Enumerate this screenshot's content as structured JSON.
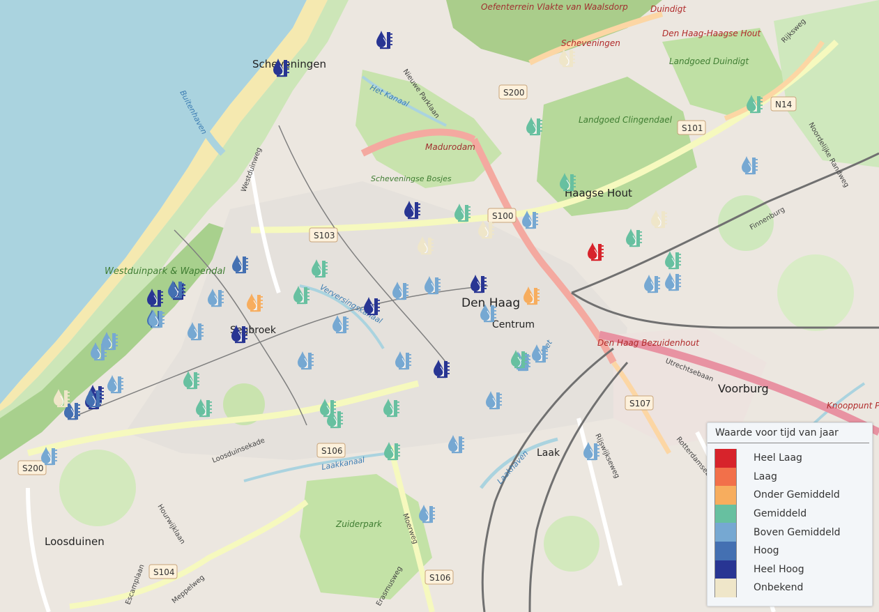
{
  "map": {
    "place_labels": [
      {
        "text": "Scheveningen",
        "kind": "district"
      },
      {
        "text": "Den Haag",
        "kind": "city"
      },
      {
        "text": "Centrum",
        "kind": "district"
      },
      {
        "text": "Haagse Hout",
        "kind": "district"
      },
      {
        "text": "Voorburg",
        "kind": "town"
      },
      {
        "text": "Laak",
        "kind": "district"
      },
      {
        "text": "Loosduinen",
        "kind": "district"
      },
      {
        "text": "Segbroek",
        "kind": "district"
      },
      {
        "text": "Westduinpark & Wapendal",
        "kind": "park"
      },
      {
        "text": "Landgoed Clingendael",
        "kind": "park"
      },
      {
        "text": "Landgoed Duindigt",
        "kind": "park"
      },
      {
        "text": "Scheveningse Bosjes",
        "kind": "park"
      },
      {
        "text": "Zuiderpark",
        "kind": "park"
      },
      {
        "text": "Oefenterrein Vlakte van Waalsdorp",
        "kind": "military"
      },
      {
        "text": "Madurodam",
        "kind": "poi"
      },
      {
        "text": "Scheveningen",
        "kind": "station"
      },
      {
        "text": "Duindigt",
        "kind": "station"
      },
      {
        "text": "Den Haag-Haagse Hout",
        "kind": "station"
      },
      {
        "text": "Den Haag Bezuidenhout",
        "kind": "station"
      },
      {
        "text": "Knooppunt Pr",
        "kind": "junction"
      },
      {
        "text": "Buitenhaven",
        "kind": "water"
      },
      {
        "text": "Het Kanaal",
        "kind": "water"
      },
      {
        "text": "Verversingskanaal",
        "kind": "water"
      },
      {
        "text": "Laakkanaal",
        "kind": "water"
      },
      {
        "text": "Laakhaven",
        "kind": "water"
      },
      {
        "text": "Vliet",
        "kind": "water"
      }
    ],
    "street_labels": [
      "Westduinweg",
      "Nieuwe Parklaan",
      "Loosduinsekade",
      "Hourwijklaan",
      "Escamplaan",
      "Meppelweg",
      "Erasmusweg",
      "Moerweg",
      "Rijksweg",
      "Rotterdamsebaan",
      "Utrechtsebaan",
      "Finnenburg",
      "Noordelijke Randweg",
      "Rijswijkseweg"
    ],
    "road_shields": [
      "S200",
      "S200",
      "S101",
      "N14",
      "S100",
      "S103",
      "S106",
      "S107",
      "S104",
      "S106",
      "S200"
    ],
    "markers": [
      {
        "category": "Heel Hoog"
      },
      {
        "category": "Heel Hoog"
      },
      {
        "category": "Heel Hoog"
      },
      {
        "category": "Heel Hoog"
      },
      {
        "category": "Heel Hoog"
      },
      {
        "category": "Heel Hoog"
      },
      {
        "category": "Heel Hoog"
      },
      {
        "category": "Heel Hoog"
      },
      {
        "category": "Heel Hoog"
      },
      {
        "category": "Heel Hoog"
      },
      {
        "category": "Heel Hoog"
      },
      {
        "category": "Heel Hoog"
      },
      {
        "category": "Hoog"
      },
      {
        "category": "Hoog"
      },
      {
        "category": "Hoog"
      },
      {
        "category": "Hoog"
      },
      {
        "category": "Hoog"
      },
      {
        "category": "Boven Gemiddeld"
      },
      {
        "category": "Boven Gemiddeld"
      },
      {
        "category": "Boven Gemiddeld"
      },
      {
        "category": "Boven Gemiddeld"
      },
      {
        "category": "Boven Gemiddeld"
      },
      {
        "category": "Boven Gemiddeld"
      },
      {
        "category": "Boven Gemiddeld"
      },
      {
        "category": "Boven Gemiddeld"
      },
      {
        "category": "Boven Gemiddeld"
      },
      {
        "category": "Boven Gemiddeld"
      },
      {
        "category": "Boven Gemiddeld"
      },
      {
        "category": "Boven Gemiddeld"
      },
      {
        "category": "Boven Gemiddeld"
      },
      {
        "category": "Boven Gemiddeld"
      },
      {
        "category": "Boven Gemiddeld"
      },
      {
        "category": "Boven Gemiddeld"
      },
      {
        "category": "Boven Gemiddeld"
      },
      {
        "category": "Boven Gemiddeld"
      },
      {
        "category": "Boven Gemiddeld"
      },
      {
        "category": "Boven Gemiddeld"
      },
      {
        "category": "Boven Gemiddeld"
      },
      {
        "category": "Boven Gemiddeld"
      },
      {
        "category": "Boven Gemiddeld"
      },
      {
        "category": "Boven Gemiddeld"
      },
      {
        "category": "Gemiddeld"
      },
      {
        "category": "Gemiddeld"
      },
      {
        "category": "Gemiddeld"
      },
      {
        "category": "Gemiddeld"
      },
      {
        "category": "Gemiddeld"
      },
      {
        "category": "Gemiddeld"
      },
      {
        "category": "Gemiddeld"
      },
      {
        "category": "Gemiddeld"
      },
      {
        "category": "Gemiddeld"
      },
      {
        "category": "Gemiddeld"
      },
      {
        "category": "Gemiddeld"
      },
      {
        "category": "Gemiddeld"
      },
      {
        "category": "Gemiddeld"
      },
      {
        "category": "Gemiddeld"
      },
      {
        "category": "Gemiddeld"
      },
      {
        "category": "Onder Gemiddeld"
      },
      {
        "category": "Onder Gemiddeld"
      },
      {
        "category": "Heel Laag"
      },
      {
        "category": "Onbekend"
      },
      {
        "category": "Onbekend"
      },
      {
        "category": "Onbekend"
      },
      {
        "category": "Onbekend"
      },
      {
        "category": "Onbekend"
      }
    ]
  },
  "legend": {
    "title": "Waarde voor tijd van jaar",
    "items": [
      {
        "label": "Heel Laag",
        "color": "#d7232b"
      },
      {
        "label": "Laag",
        "color": "#f2704a"
      },
      {
        "label": "Onder Gemiddeld",
        "color": "#f7ad5e"
      },
      {
        "label": "Gemiddeld",
        "color": "#67c0a0"
      },
      {
        "label": "Boven Gemiddeld",
        "color": "#76a8d2"
      },
      {
        "label": "Hoog",
        "color": "#4470b2"
      },
      {
        "label": "Heel Hoog",
        "color": "#283593"
      },
      {
        "label": "Onbekend",
        "color": "#efe6c9"
      }
    ]
  }
}
